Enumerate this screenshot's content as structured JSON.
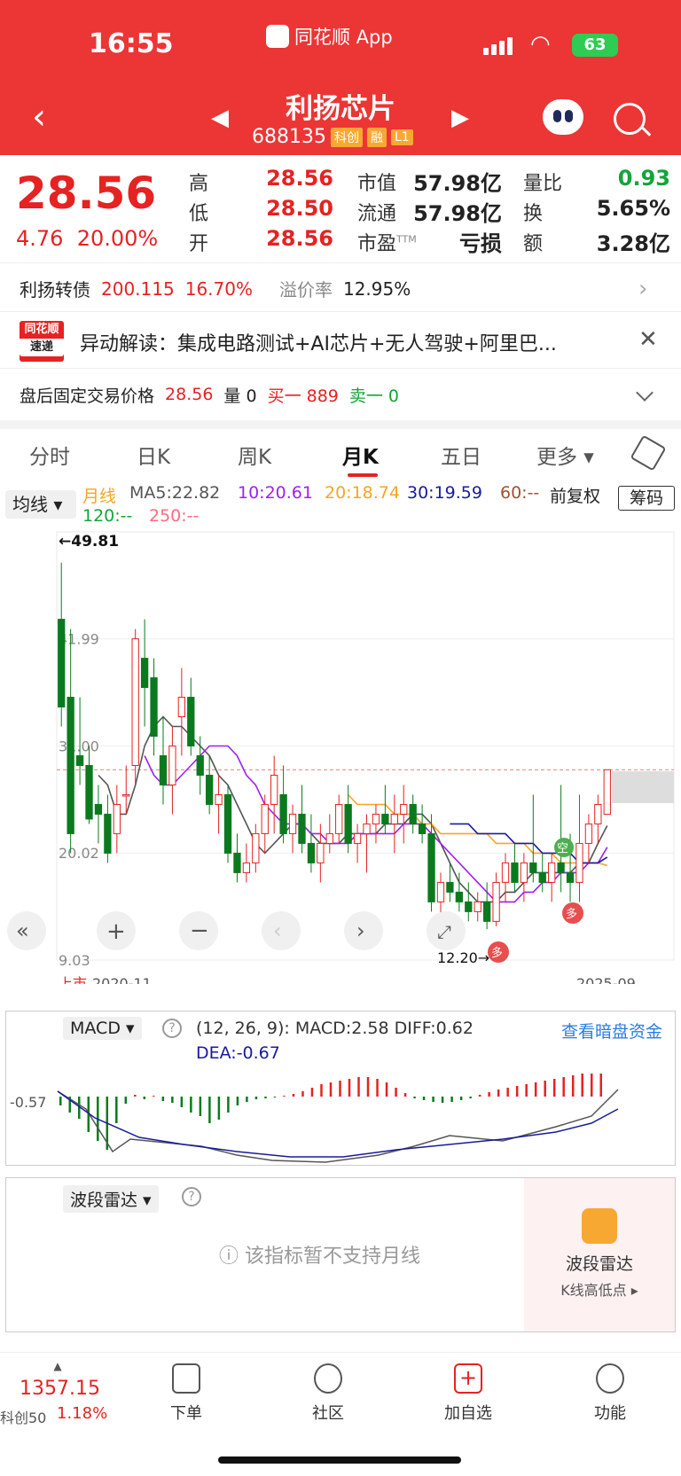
{
  "status": {
    "time": "16:55",
    "app": "同花顺 App",
    "battery": "63"
  },
  "stock": {
    "name": "利扬芯片",
    "code": "688135",
    "tags": [
      "科创",
      "融",
      "L1"
    ]
  },
  "quote": {
    "price": "28.56",
    "change": "4.76",
    "change_pct": "20.00%",
    "high_label": "高",
    "high": "28.56",
    "low_label": "低",
    "low": "28.50",
    "open_label": "开",
    "open": "28.56",
    "mktcap_label": "市值",
    "mktcap": "57.98亿",
    "float_label": "流通",
    "float": "57.98亿",
    "pe_label": "市盈",
    "pe_sup": "TTM",
    "pe": "亏损",
    "volratio_label": "量比",
    "volratio": "0.93",
    "turnover_label": "换",
    "turnover": "5.65%",
    "amount_label": "额",
    "amount": "3.28亿"
  },
  "bond": {
    "name": "利扬转债",
    "price": "200.115",
    "pct": "16.70%",
    "premium_label": "溢价率",
    "premium": "12.95%"
  },
  "alert": {
    "logo_top": "同花顺",
    "logo_bottom": "速递",
    "text": "异动解读：集成电路测试+AI芯片+无人驾驶+阿里巴..."
  },
  "after_hours": {
    "label": "盘后固定交易价格",
    "price": "28.56",
    "vol_label": "量 0",
    "buy1": "买一 889",
    "sell1": "卖一 0"
  },
  "tabs": [
    "分时",
    "日K",
    "周K",
    "月K",
    "五日",
    "更多"
  ],
  "ma": {
    "select": "均线",
    "type": "月线",
    "ma5": "MA5:22.82",
    "ma10": "10:20.61",
    "ma20": "20:18.74",
    "ma30": "30:19.59",
    "ma60": "60:--",
    "ma120": "120:--",
    "ma250": "250:--",
    "fq": "前复权",
    "chouma": "筹码",
    "colors": {
      "ma5": "#555555",
      "ma10": "#a020f0",
      "ma20": "#f5a623",
      "ma30": "#1a1a9e"
    }
  },
  "chart_labels": {
    "max_arrow": "←49.81",
    "min_arrow": "12.20→",
    "ipo": "上市",
    "start_date": "2020-11",
    "end_date": "2025-09",
    "kong": "空",
    "duo": "多",
    "yticks": [
      "41.99",
      "31.00",
      "20.02",
      "9.03"
    ]
  },
  "macd": {
    "label": "MACD",
    "params": "(12, 26, 9):",
    "macd": "MACD:2.58",
    "diff": "DIFF:0.62",
    "dea": "DEA:-0.67",
    "ylabel": "-0.57",
    "link": "查看暗盘资金"
  },
  "radar": {
    "label": "波段雷达",
    "msg": "该指标暂不支持月线",
    "promo_title": "波段雷达",
    "promo_sub": "K线高低点"
  },
  "bottom_nav": {
    "index_value": "1357.15",
    "index_name": "科创50",
    "index_pct": "1.18%",
    "items": [
      "下单",
      "社区",
      "加自选",
      "功能"
    ]
  },
  "chart_data": {
    "type": "candlestick",
    "y_range": [
      9.03,
      52.97
    ],
    "yticks": [
      41.99,
      31.0,
      20.02,
      9.03
    ],
    "x_range": [
      "2020-11",
      "2025-09"
    ],
    "max": 49.81,
    "min": 12.2,
    "last": 28.56,
    "candles": [
      [
        44,
        49.81,
        33,
        35
      ],
      [
        36,
        43,
        20,
        22
      ],
      [
        30,
        36,
        27,
        29
      ],
      [
        29,
        31,
        23,
        23.5
      ],
      [
        25,
        27,
        21,
        24
      ],
      [
        24,
        26,
        19,
        20
      ],
      [
        22,
        27,
        20,
        25
      ],
      [
        26,
        29,
        24,
        26
      ],
      [
        29,
        43,
        27,
        42
      ],
      [
        40,
        44,
        33,
        37
      ],
      [
        38,
        40,
        30,
        32
      ],
      [
        30,
        34,
        25,
        27
      ],
      [
        27,
        33,
        24,
        31
      ],
      [
        34,
        39,
        30,
        36
      ],
      [
        36,
        38,
        30,
        31
      ],
      [
        30,
        32,
        26,
        28
      ],
      [
        28,
        30,
        24,
        25
      ],
      [
        25,
        28,
        22,
        26
      ],
      [
        26,
        27,
        19,
        20
      ],
      [
        20,
        22,
        17,
        18
      ],
      [
        18,
        21,
        17,
        19
      ],
      [
        19,
        23,
        18,
        22
      ],
      [
        22,
        26,
        20,
        25
      ],
      [
        25,
        30,
        22,
        28
      ],
      [
        26,
        29,
        21,
        22
      ],
      [
        22,
        25,
        20,
        24
      ],
      [
        24,
        27,
        20,
        21
      ],
      [
        21,
        24,
        18,
        19
      ],
      [
        19,
        23,
        17,
        21
      ],
      [
        21,
        24,
        20,
        22
      ],
      [
        22,
        26,
        21,
        25
      ],
      [
        25,
        27,
        20,
        21
      ],
      [
        21,
        23,
        19,
        22
      ],
      [
        22,
        24,
        18,
        23
      ],
      [
        23,
        25,
        21,
        24
      ],
      [
        24,
        27,
        22,
        23
      ],
      [
        23,
        26,
        20,
        24
      ],
      [
        24,
        27,
        21,
        25
      ],
      [
        25,
        26,
        22,
        23
      ],
      [
        23,
        25,
        21,
        22
      ],
      [
        22,
        24,
        14,
        15
      ],
      [
        15,
        18,
        13,
        17
      ],
      [
        17,
        19,
        15,
        16
      ],
      [
        16,
        18,
        14,
        15
      ],
      [
        15,
        17,
        13,
        14
      ],
      [
        14,
        16,
        13,
        15
      ],
      [
        15,
        17,
        12.2,
        13
      ],
      [
        13,
        18,
        12.5,
        17
      ],
      [
        17,
        20,
        15,
        19
      ],
      [
        19,
        21,
        16,
        17
      ],
      [
        17,
        20,
        15,
        19
      ],
      [
        19,
        26,
        17,
        18
      ],
      [
        18,
        20,
        16,
        17
      ],
      [
        17,
        20,
        15,
        19
      ],
      [
        19,
        27,
        16,
        18
      ],
      [
        18,
        22,
        15,
        17
      ],
      [
        17,
        26,
        15,
        21
      ],
      [
        21,
        24,
        19,
        23
      ],
      [
        23,
        26,
        21,
        25
      ],
      [
        24,
        28.56,
        24,
        28.56
      ]
    ],
    "ma5": [
      null,
      null,
      null,
      null,
      28,
      27,
      24,
      24,
      27,
      31,
      33,
      34,
      33,
      33,
      32,
      31,
      30,
      28,
      27,
      25,
      23,
      21,
      20,
      21,
      22,
      23,
      23,
      22,
      21,
      21,
      21,
      22,
      22,
      22,
      22,
      23,
      23,
      23,
      24,
      24,
      23,
      21,
      19,
      17,
      16,
      15,
      15,
      15,
      16,
      16,
      17,
      18,
      18,
      18,
      18,
      18,
      19,
      19,
      21,
      22.82
    ],
    "ma10": [
      null,
      null,
      null,
      null,
      null,
      null,
      null,
      null,
      null,
      30,
      28,
      27,
      27,
      28,
      29,
      30,
      31,
      31,
      31,
      30,
      28,
      27,
      25,
      24,
      23,
      23,
      23,
      22,
      22,
      21,
      21,
      21,
      22,
      22,
      22,
      22,
      22,
      23,
      23,
      23,
      22,
      21,
      20,
      19,
      18,
      17,
      16,
      15,
      15,
      15,
      16,
      16,
      17,
      17,
      18,
      18,
      18,
      19,
      19,
      20.61
    ],
    "ma20": [
      null,
      null,
      null,
      null,
      null,
      null,
      null,
      null,
      null,
      null,
      null,
      null,
      26,
      25,
      25,
      25,
      25,
      24,
      24,
      24,
      23,
      23,
      22,
      22,
      22,
      22,
      22,
      22,
      21,
      21,
      21,
      21,
      20,
      20,
      20,
      19,
      19,
      19,
      19,
      19,
      18.74
    ],
    "ma30": [
      null,
      null,
      null,
      null,
      null,
      null,
      null,
      null,
      null,
      null,
      null,
      null,
      null,
      null,
      null,
      null,
      null,
      null,
      null,
      null,
      null,
      23,
      23,
      23,
      22,
      22,
      22,
      22,
      21,
      21,
      21,
      20,
      20,
      20,
      20,
      19,
      19,
      19,
      19.59
    ]
  }
}
